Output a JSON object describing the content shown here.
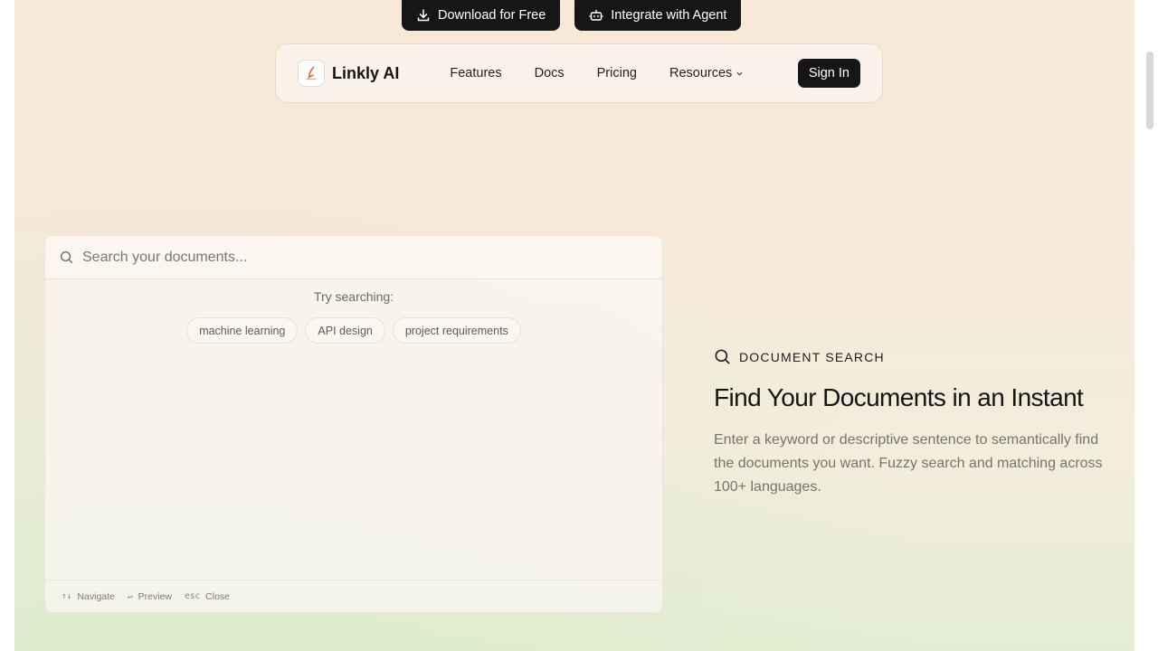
{
  "cta": {
    "download_label": "Download for Free",
    "download_icon": "download-icon",
    "agent_label": "Integrate with Agent",
    "agent_icon": "robot-icon"
  },
  "nav": {
    "brand": "Linkly AI",
    "links": [
      "Features",
      "Docs",
      "Pricing",
      "Resources"
    ],
    "signin_label": "Sign In"
  },
  "search": {
    "placeholder": "Search your documents...",
    "try_label": "Try searching:",
    "suggestions": [
      "machine learning",
      "API design",
      "project requirements"
    ],
    "footer": {
      "navigate_key": "↑↓",
      "navigate_label": "Navigate",
      "preview_key": "↵",
      "preview_label": "Preview",
      "close_key": "esc",
      "close_label": "Close"
    }
  },
  "feature": {
    "eyebrow": "DOCUMENT SEARCH",
    "title": "Find Your Documents in an Instant",
    "description": "Enter a keyword or descriptive sentence to semantically find the documents you want. Fuzzy search and matching across 100+ languages."
  },
  "colors": {
    "button_dark": "#161616",
    "logo_accent": "#e0734f"
  }
}
